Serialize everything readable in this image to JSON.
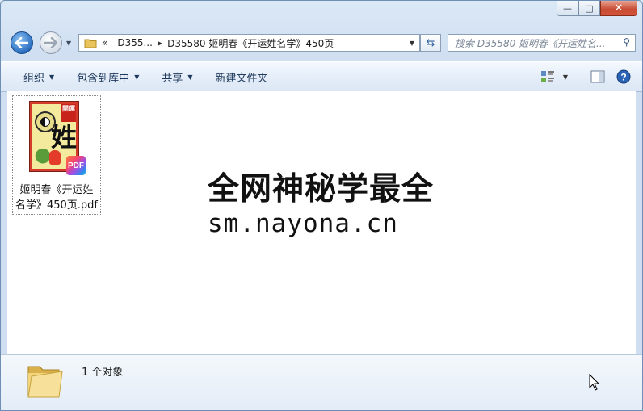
{
  "window": {
    "minimize_glyph": "—",
    "maximize_glyph": "□",
    "close_glyph": "✕"
  },
  "nav": {
    "back_icon": "back-arrow-icon",
    "forward_icon": "forward-arrow-icon"
  },
  "address": {
    "overflow": "«",
    "crumb_parent": "D355...",
    "crumb_current": "D35580 姬明春《开运姓名学》450页"
  },
  "search": {
    "placeholder": "搜索 D35580 姬明春《开运姓名..."
  },
  "toolbar": {
    "organize": "组织",
    "include_in_library": "包含到库中",
    "share": "共享",
    "new_folder": "新建文件夹"
  },
  "files": [
    {
      "name_line1": "姬明春《开运姓",
      "name_line2": "名学》450页.pdf",
      "badge": "PDF",
      "cover_title": "開運",
      "cover_char": "姓"
    }
  ],
  "watermark": {
    "line1": "全网神秘学最全",
    "line2": "sm.nayona.cn"
  },
  "details": {
    "count": "1 个对象"
  },
  "colors": {
    "accent": "#2b6fc0",
    "close": "#c74a31",
    "toolbar_text": "#1e395b"
  }
}
